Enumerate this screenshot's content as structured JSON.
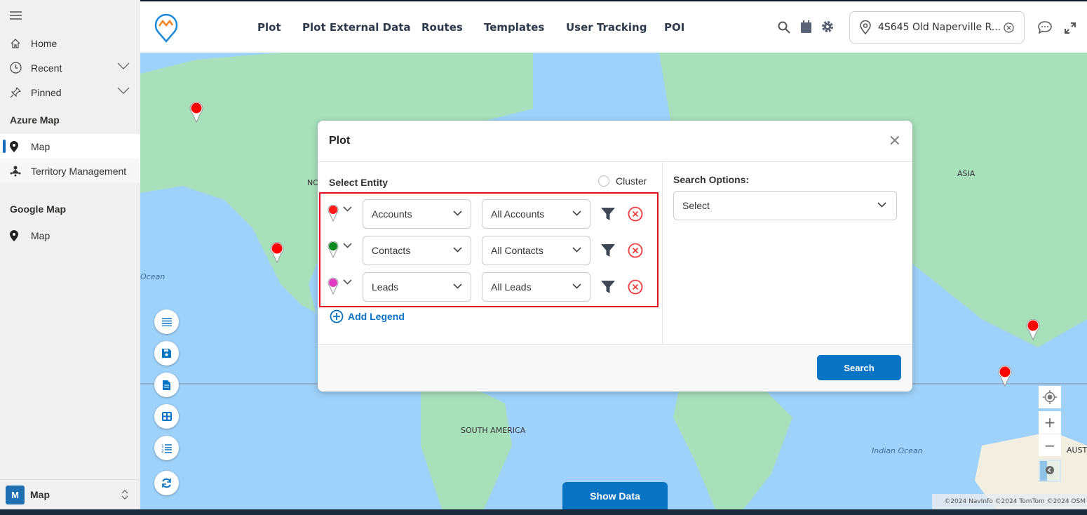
{
  "sidebar": {
    "items": [
      {
        "label": "Home",
        "icon": "home-icon"
      },
      {
        "label": "Recent",
        "icon": "clock-icon"
      },
      {
        "label": "Pinned",
        "icon": "pin-icon"
      }
    ],
    "sections": [
      {
        "title": "Azure Map",
        "items": [
          {
            "label": "Map",
            "selected": true
          },
          {
            "label": "Territory Management"
          }
        ]
      },
      {
        "title": "Google Map",
        "items": [
          {
            "label": "Map"
          }
        ]
      }
    ],
    "footer": {
      "badge": "M",
      "label": "Map"
    }
  },
  "topnav": [
    "Plot",
    "Plot External Data",
    "Routes",
    "Templates",
    "User Tracking",
    "POI"
  ],
  "address": "4S645 Old Naperville R...",
  "map": {
    "labels": [
      "NO",
      "ASIA",
      "Ocean",
      "SOUTH AMERICA",
      "Indian Ocean",
      "AUST"
    ],
    "show_data": "Show Data",
    "attribution": "©2024 NavInfo ©2024 TomTom ©2024 OSM"
  },
  "modal": {
    "title": "Plot",
    "select_entity": "Select Entity",
    "cluster": "Cluster",
    "rows": [
      {
        "color": "#ff1a1a",
        "entity": "Accounts",
        "view": "All Accounts"
      },
      {
        "color": "#0a8a1e",
        "entity": "Contacts",
        "view": "All Contacts"
      },
      {
        "color": "#e23cc4",
        "entity": "Leads",
        "view": "All Leads"
      }
    ],
    "add_legend": "Add Legend",
    "search_options": "Search Options:",
    "select_placeholder": "Select",
    "search": "Search"
  },
  "colors": {
    "accent": "#0a74c4",
    "highlight": "#e0141e"
  }
}
